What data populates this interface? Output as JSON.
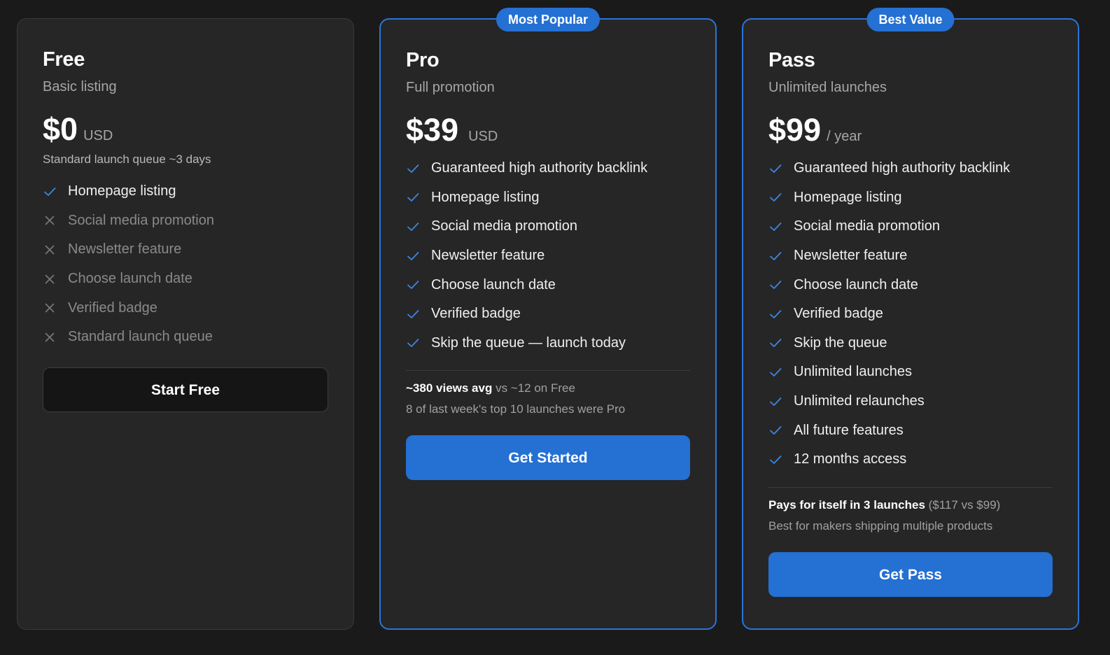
{
  "colors": {
    "background": "#1a1a1a",
    "card": "#262626",
    "accent": "#2470d3",
    "check": "#3d86e0",
    "cross": "#7a7a7a"
  },
  "plans": [
    {
      "name": "Free",
      "tagline": "Basic listing",
      "price": "$0",
      "unit": "USD",
      "note": "Standard launch queue ~3 days",
      "features": [
        {
          "label": "Homepage listing",
          "icon": "check-icon"
        },
        {
          "label": "Social media promotion",
          "icon": "cross-icon"
        },
        {
          "label": "Newsletter feature",
          "icon": "cross-icon"
        },
        {
          "label": "Choose launch date",
          "icon": "cross-icon"
        },
        {
          "label": "Verified badge",
          "icon": "cross-icon"
        },
        {
          "label": "Standard launch queue",
          "icon": "cross-icon"
        }
      ],
      "cta": "Start Free"
    },
    {
      "name": "Pro",
      "ribbon": "Most Popular",
      "tagline": "Full promotion",
      "price": "$39",
      "unit": "USD",
      "features": [
        {
          "label": "Guaranteed high authority backlink",
          "icon": "check-icon"
        },
        {
          "label": "Homepage listing",
          "icon": "check-icon"
        },
        {
          "label": "Social media promotion",
          "icon": "check-icon"
        },
        {
          "label": "Newsletter feature",
          "icon": "check-icon"
        },
        {
          "label": "Choose launch date",
          "icon": "check-icon"
        },
        {
          "label": "Verified badge",
          "icon": "check-icon"
        },
        {
          "label": "Skip the queue — launch today",
          "icon": "check-icon"
        }
      ],
      "stat_strong": "~380 views avg",
      "stat_rest": " vs ~12 on Free",
      "stat_line2": "8 of last week's top 10 launches were Pro",
      "cta": "Get Started"
    },
    {
      "name": "Pass",
      "ribbon": "Best Value",
      "tagline": "Unlimited launches",
      "price": "$99",
      "unit": "/ year",
      "features": [
        {
          "label": "Guaranteed high authority backlink",
          "icon": "check-icon"
        },
        {
          "label": "Homepage listing",
          "icon": "check-icon"
        },
        {
          "label": "Social media promotion",
          "icon": "check-icon"
        },
        {
          "label": "Newsletter feature",
          "icon": "check-icon"
        },
        {
          "label": "Choose launch date",
          "icon": "check-icon"
        },
        {
          "label": "Verified badge",
          "icon": "check-icon"
        },
        {
          "label": "Skip the queue",
          "icon": "check-icon"
        },
        {
          "label": "Unlimited launches",
          "icon": "check-icon"
        },
        {
          "label": "Unlimited relaunches",
          "icon": "check-icon"
        },
        {
          "label": "All future features",
          "icon": "check-icon"
        },
        {
          "label": "12 months access",
          "icon": "check-icon"
        }
      ],
      "stat_strong": "Pays for itself in 3 launches",
      "stat_rest": " ($117 vs $99)",
      "stat_line2": "Best for makers shipping multiple products",
      "cta": "Get Pass"
    }
  ]
}
